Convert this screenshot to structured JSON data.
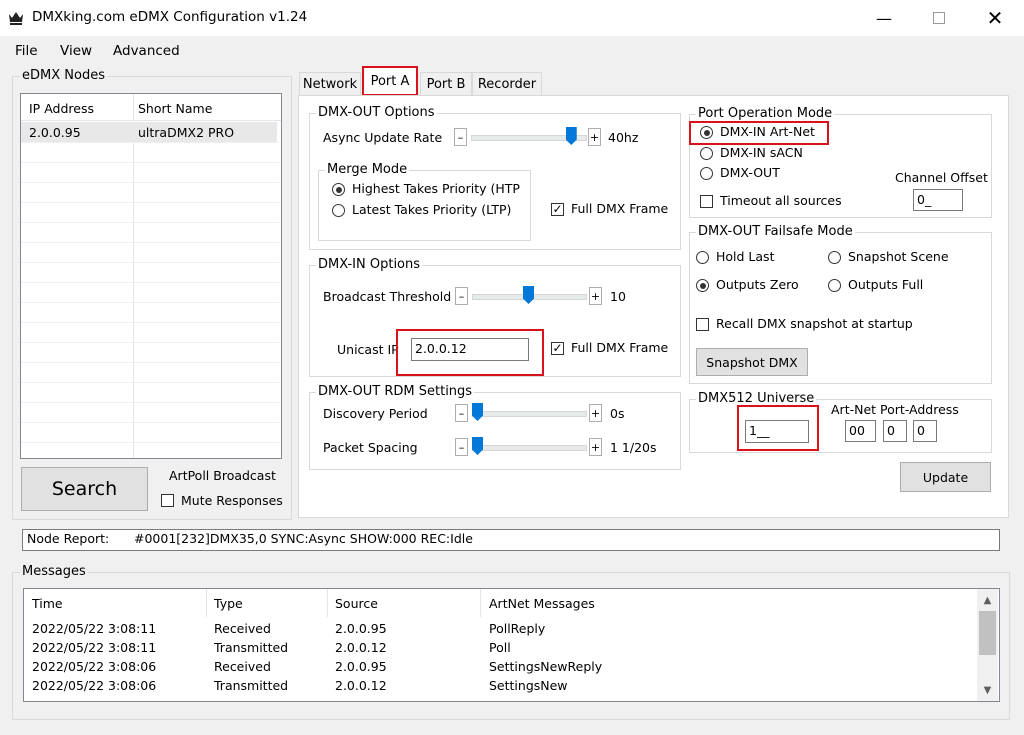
{
  "window": {
    "title": "DMXking.com eDMX Configuration v1.24",
    "minimize_icon": "minimize-icon",
    "maximize_icon": "maximize-icon",
    "close_icon": "close-icon"
  },
  "menu": [
    "File",
    "View",
    "Advanced"
  ],
  "nodes": {
    "group_label": "eDMX Nodes",
    "columns": [
      "IP Address",
      "Short Name"
    ],
    "rows": [
      {
        "ip": "2.0.0.95",
        "name": "ultraDMX2 PRO"
      }
    ]
  },
  "search": {
    "label": "Search"
  },
  "artpoll": {
    "label": "ArtPoll Broadcast",
    "mute_label": "Mute Responses"
  },
  "tabs": [
    "Network",
    "Port A",
    "Port B",
    "Recorder"
  ],
  "dmx_out": {
    "group_label": "DMX-OUT Options",
    "async_label": "Async Update Rate",
    "async_value": "40hz",
    "async_level": 0.92,
    "merge_label": "Merge Mode",
    "merge_htp": "Highest Takes Priority (HTP",
    "merge_ltp": "Latest Takes Priority (LTP)",
    "full_frame": "Full DMX Frame"
  },
  "dmx_in": {
    "group_label": "DMX-IN Options",
    "threshold_label": "Broadcast Threshold",
    "threshold_value": "10",
    "threshold_level": 0.5,
    "unicast_label": "Unicast IP",
    "unicast_value": "2.0.0.12",
    "full_frame": "Full DMX Frame"
  },
  "rdm": {
    "group_label": "DMX-OUT RDM Settings",
    "discovery_label": "Discovery Period",
    "discovery_value": "0s",
    "discovery_level": 0.0,
    "spacing_label": "Packet Spacing",
    "spacing_value": "1 1/20s",
    "spacing_level": 0.0
  },
  "port_mode": {
    "group_label": "Port Operation Mode",
    "options": [
      "DMX-IN Art-Net",
      "DMX-IN sACN",
      "DMX-OUT"
    ],
    "timeout_label": "Timeout all sources",
    "channel_offset_label": "Channel Offset",
    "channel_offset_value": "0_"
  },
  "failsafe": {
    "group_label": "DMX-OUT Failsafe Mode",
    "hold_last": "Hold Last",
    "snapshot_scene": "Snapshot Scene",
    "outputs_zero": "Outputs Zero",
    "outputs_full": "Outputs Full",
    "recall_label": "Recall DMX snapshot at startup",
    "snapshot_button": "Snapshot DMX"
  },
  "universe": {
    "group_label": "DMX512 Universe",
    "value": "1__",
    "artnet_label": "Art-Net Port-Address",
    "addr": [
      "00",
      "0",
      "0"
    ]
  },
  "update": {
    "label": "Update"
  },
  "node_report": {
    "label": "Node Report:",
    "value": "#0001[232]DMX35,0 SYNC:Async SHOW:000 REC:Idle"
  },
  "messages": {
    "group_label": "Messages",
    "columns": [
      "Time",
      "Type",
      "Source",
      "ArtNet Messages"
    ],
    "rows": [
      {
        "time": "2022/05/22 3:08:11",
        "type": "Received",
        "source": "2.0.0.95",
        "msg": "PollReply"
      },
      {
        "time": "2022/05/22 3:08:11",
        "type": "Transmitted",
        "source": "2.0.0.12",
        "msg": "Poll"
      },
      {
        "time": "2022/05/22 3:08:06",
        "type": "Received",
        "source": "2.0.0.95",
        "msg": "SettingsNewReply"
      },
      {
        "time": "2022/05/22 3:08:06",
        "type": "Transmitted",
        "source": "2.0.0.12",
        "msg": "SettingsNew"
      }
    ]
  },
  "colors": {
    "accent": "#0078d7",
    "highlight": "#d9121b"
  }
}
